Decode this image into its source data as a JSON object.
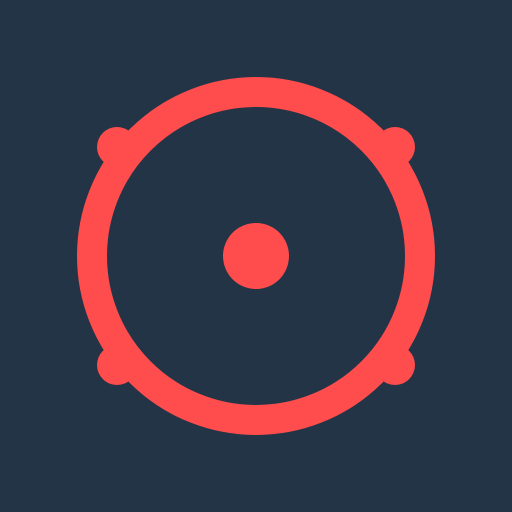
{
  "colors": {
    "background": "#233447",
    "accent": "#FF4D4D"
  },
  "icon": {
    "name": "target-icon"
  }
}
